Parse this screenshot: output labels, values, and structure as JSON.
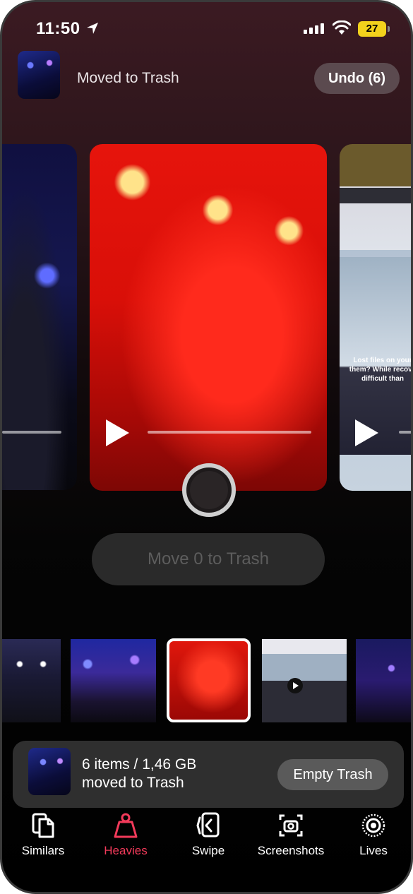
{
  "status_bar": {
    "time": "11:50",
    "battery": "27"
  },
  "header": {
    "title": "Moved to Trash",
    "undo_label": "Undo (6)"
  },
  "carousel": {
    "right_card_text": "Lost files on your them? While recove difficult than"
  },
  "actions": {
    "move_label": "Move 0 to Trash"
  },
  "trash_banner": {
    "line1": "6 items / 1,46 GB",
    "line2": "moved to Trash",
    "empty_label": "Empty Trash"
  },
  "tabs": [
    {
      "label": "Similars",
      "icon": "similars-icon",
      "active": false
    },
    {
      "label": "Heavies",
      "icon": "weight-icon",
      "active": true
    },
    {
      "label": "Swipe",
      "icon": "swipe-icon",
      "active": false
    },
    {
      "label": "Screenshots",
      "icon": "screenshot-icon",
      "active": false
    },
    {
      "label": "Lives",
      "icon": "live-photo-icon",
      "active": false
    }
  ],
  "colors": {
    "accent": "#f23a5a",
    "battery": "#f2d21c"
  }
}
